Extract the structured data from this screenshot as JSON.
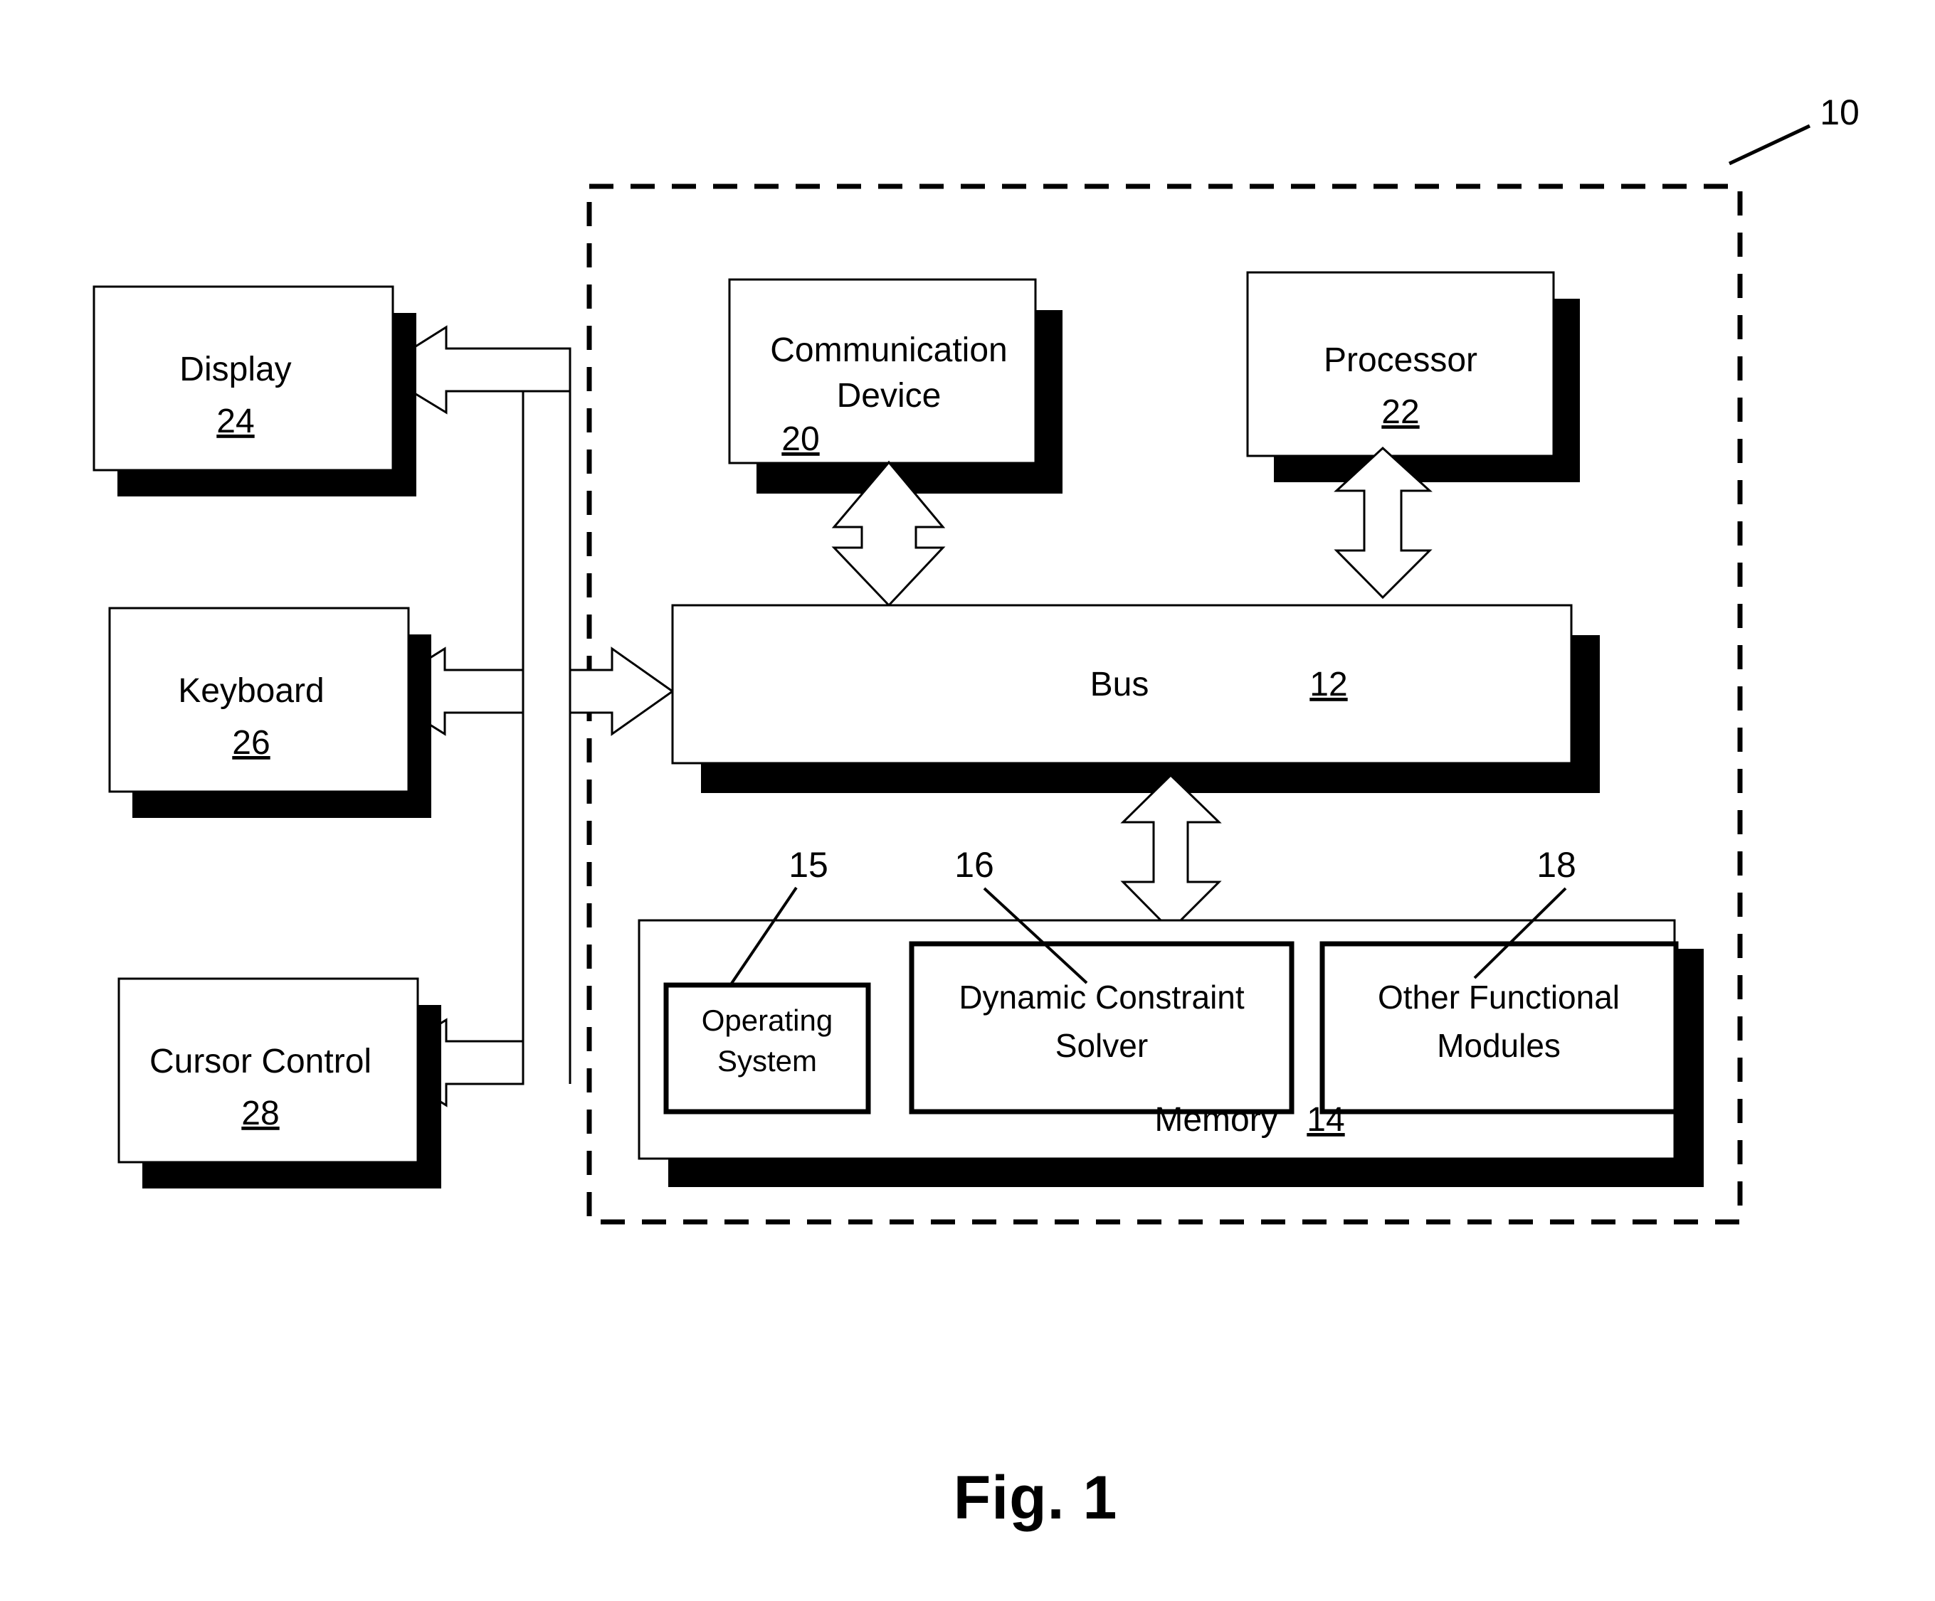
{
  "figure": {
    "caption": "Fig. 1",
    "system_ref": "10"
  },
  "nodes": {
    "display": {
      "label": "Display",
      "ref": "24"
    },
    "keyboard": {
      "label": "Keyboard",
      "ref": "26"
    },
    "cursor_control": {
      "label": "Cursor Control",
      "ref": "28"
    },
    "communication": {
      "label_line1": "Communication",
      "label_line2": "Device",
      "ref": "20"
    },
    "processor": {
      "label": "Processor",
      "ref": "22"
    },
    "bus": {
      "label": "Bus",
      "ref": "12"
    },
    "memory": {
      "label": "Memory",
      "ref": "14"
    }
  },
  "memory_modules": [
    {
      "label_line1": "Operating",
      "label_line2": "System",
      "ref": "15"
    },
    {
      "label_line1": "Dynamic Constraint",
      "label_line2": "Solver",
      "ref": "16"
    },
    {
      "label_line1": "Other Functional",
      "label_line2": "Modules",
      "ref": "18"
    }
  ],
  "colors": {
    "stroke": "#000000",
    "fill": "#ffffff",
    "shadow": "#000000"
  }
}
